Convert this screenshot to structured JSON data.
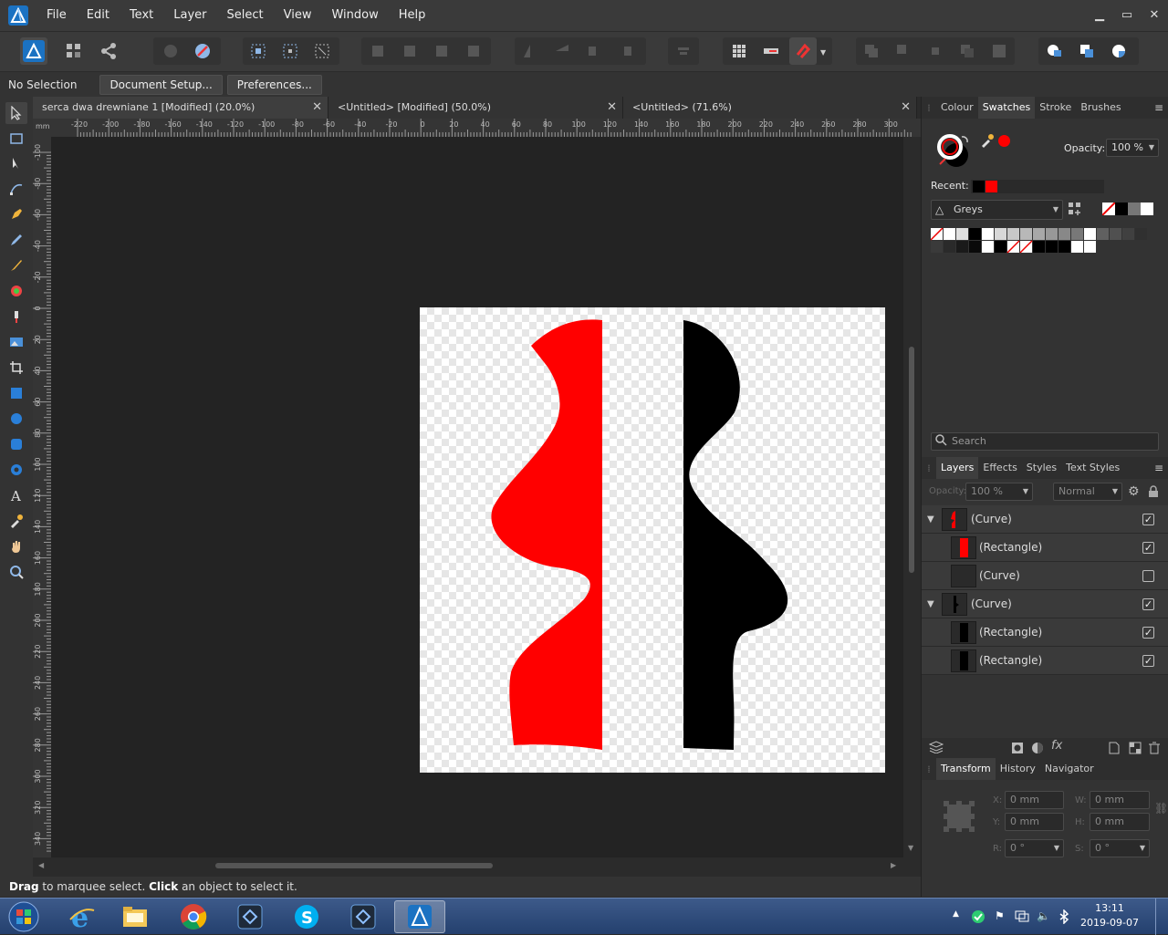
{
  "menubar": {
    "items": [
      "File",
      "Edit",
      "Text",
      "Layer",
      "Select",
      "View",
      "Window",
      "Help"
    ],
    "win_min": "▁",
    "win_max": "▭",
    "win_close": "✕"
  },
  "contextbar": {
    "selection_text": "No Selection",
    "document_setup": "Document Setup...",
    "preferences": "Preferences..."
  },
  "tabs": [
    {
      "label": "serca dwa drewniane 1 [Modified] (20.0%)",
      "close": "✕"
    },
    {
      "label": "<Untitled> [Modified] (50.0%)",
      "close": "✕"
    },
    {
      "label": "<Untitled> (71.6%)",
      "close": "✕"
    }
  ],
  "rulers": {
    "unit": "mm",
    "h_ticks": [
      "-220",
      "-200",
      "-180",
      "-160",
      "-140",
      "-120",
      "-100",
      "-80",
      "-60",
      "-40",
      "-20",
      "0",
      "20",
      "40",
      "60",
      "80",
      "100",
      "120",
      "140",
      "160",
      "180",
      "200",
      "220",
      "240",
      "260",
      "280",
      "300"
    ],
    "v_ticks": [
      "-100",
      "-80",
      "-60",
      "-40",
      "-20",
      "0",
      "20",
      "40",
      "60",
      "80",
      "100",
      "120",
      "140",
      "160",
      "180",
      "200",
      "220",
      "240",
      "260",
      "280",
      "300",
      "320",
      "340"
    ]
  },
  "status": {
    "drag": "Drag",
    "rest1": " to marquee select. ",
    "click": "Click",
    "rest2": " an object to select it."
  },
  "swatches_panel": {
    "tabs": [
      "Colour",
      "Swatches",
      "Stroke",
      "Brushes"
    ],
    "active_tab": "Swatches",
    "opacity_label": "Opacity:",
    "opacity_value": "100 %",
    "recent_label": "Recent:",
    "palette_name": "Greys",
    "search_placeholder": "Search",
    "colors": {
      "red": "#ff0000",
      "black": "#000000"
    }
  },
  "layers_panel": {
    "tabs": [
      "Layers",
      "Effects",
      "Styles",
      "Text Styles"
    ],
    "active_tab": "Layers",
    "opacity_label": "Opacity:",
    "opacity_value": "100 %",
    "blend_mode": "Normal",
    "layers": [
      {
        "name": "(Curve)",
        "expanded": true,
        "checked": true
      },
      {
        "name": "(Rectangle)",
        "checked": true
      },
      {
        "name": "(Curve)",
        "checked": false
      },
      {
        "name": "(Curve)",
        "expanded": true,
        "checked": true
      },
      {
        "name": "(Rectangle)",
        "checked": true
      },
      {
        "name": "(Rectangle)",
        "checked": true
      }
    ]
  },
  "transform_panel": {
    "tabs": [
      "Transform",
      "History",
      "Navigator"
    ],
    "active_tab": "Transform",
    "x_label": "X:",
    "x_value": "0 mm",
    "y_label": "Y:",
    "y_value": "0 mm",
    "w_label": "W:",
    "w_value": "0 mm",
    "h_label": "H:",
    "h_value": "0 mm",
    "r_label": "R:",
    "r_value": "0 °",
    "s_label": "S:",
    "s_value": "0 °"
  },
  "taskbar": {
    "time": "13:11",
    "date": "2019-09-07"
  }
}
